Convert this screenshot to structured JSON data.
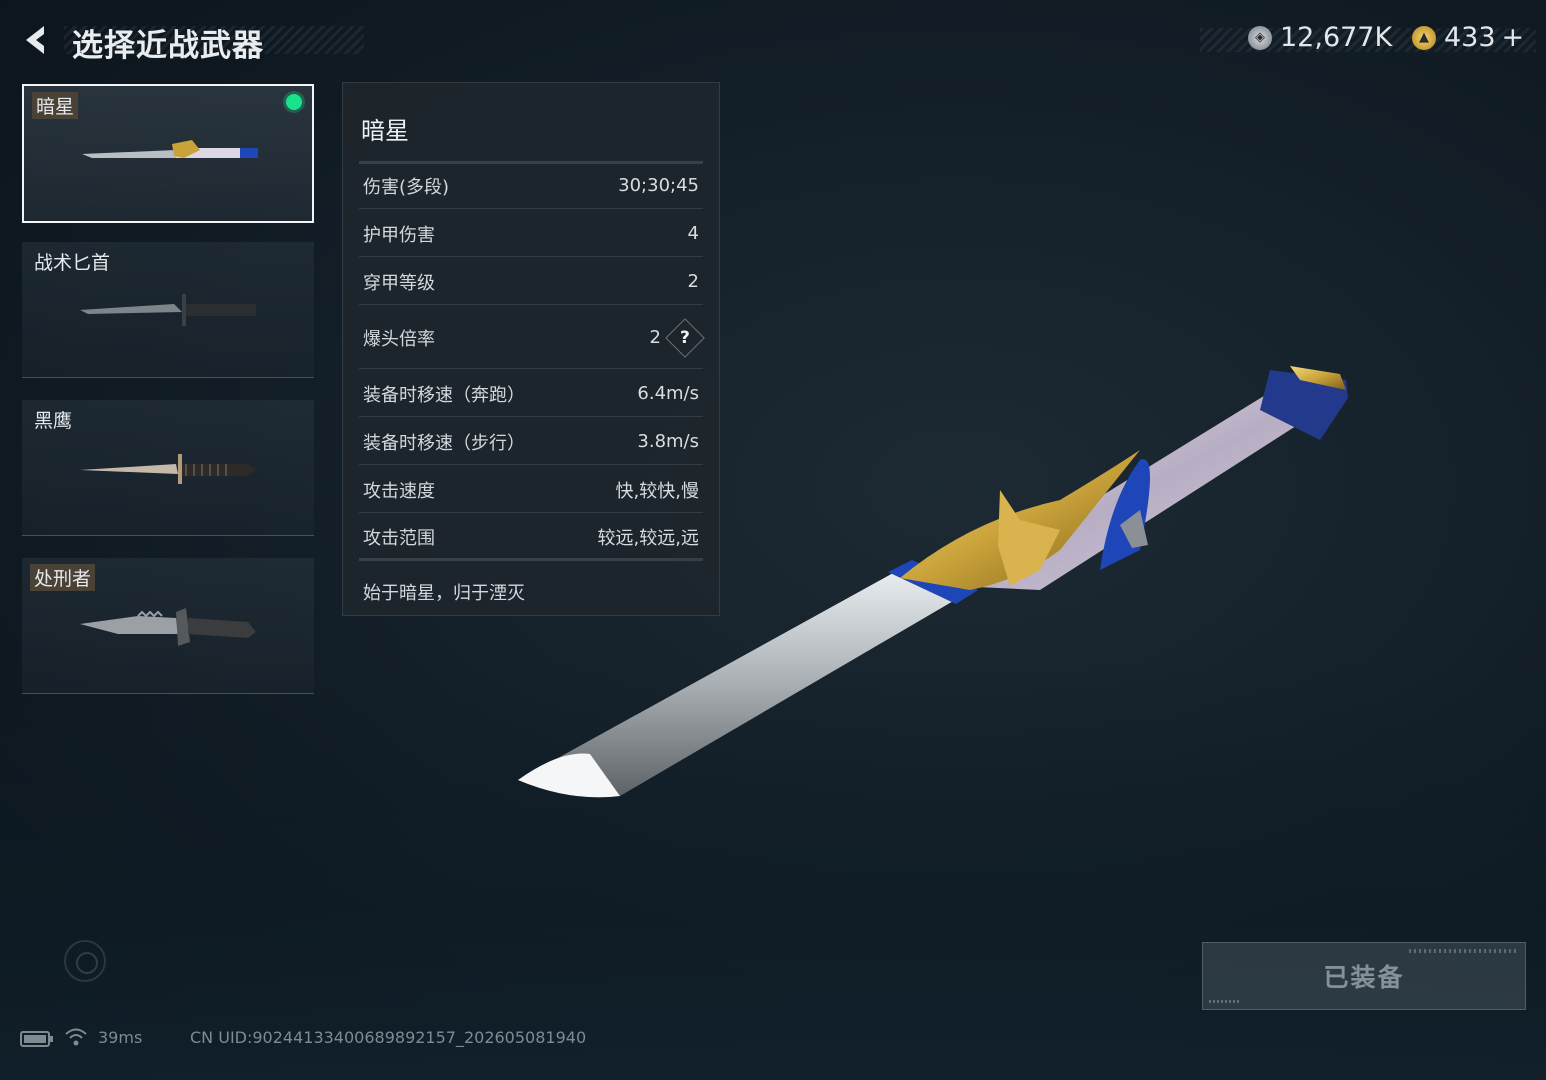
{
  "header": {
    "title": "选择近战武器",
    "back_icon": "chevron-left-icon"
  },
  "currency": {
    "silver": {
      "icon": "silver-coin-icon",
      "value": "12,677K"
    },
    "gold": {
      "icon": "gold-coin-icon",
      "value": "433",
      "add_label": "+"
    }
  },
  "weapons": [
    {
      "name": "暗星",
      "selected": true,
      "equipped": true
    },
    {
      "name": "战术匕首",
      "selected": false
    },
    {
      "name": "黑鹰",
      "selected": false
    },
    {
      "name": "处刑者",
      "selected": false
    }
  ],
  "details": {
    "name": "暗星",
    "stats": [
      {
        "label": "伤害(多段)",
        "value": "30;30;45"
      },
      {
        "label": "护甲伤害",
        "value": "4"
      },
      {
        "label": "穿甲等级",
        "value": "2"
      },
      {
        "label": "爆头倍率",
        "value": "2",
        "help": "?"
      },
      {
        "label": "装备时移速（奔跑）",
        "value": "6.4m/s"
      },
      {
        "label": "装备时移速（步行）",
        "value": "3.8m/s"
      },
      {
        "label": "攻击速度",
        "value": "快,较快,慢"
      },
      {
        "label": "攻击范围",
        "value": "较远,较远,远"
      }
    ],
    "description": "始于暗星，归于湮灭"
  },
  "equip_button": {
    "label": "已装备"
  },
  "status_bar": {
    "ping": "39ms",
    "uid": "CN UID:9024413340068989215‍7_202605081940"
  },
  "colors": {
    "equipped_dot": "#19e38a",
    "panel_bg": "#1e262d",
    "accent_gold": "#c9a23a",
    "accent_blue": "#1f46b8"
  }
}
